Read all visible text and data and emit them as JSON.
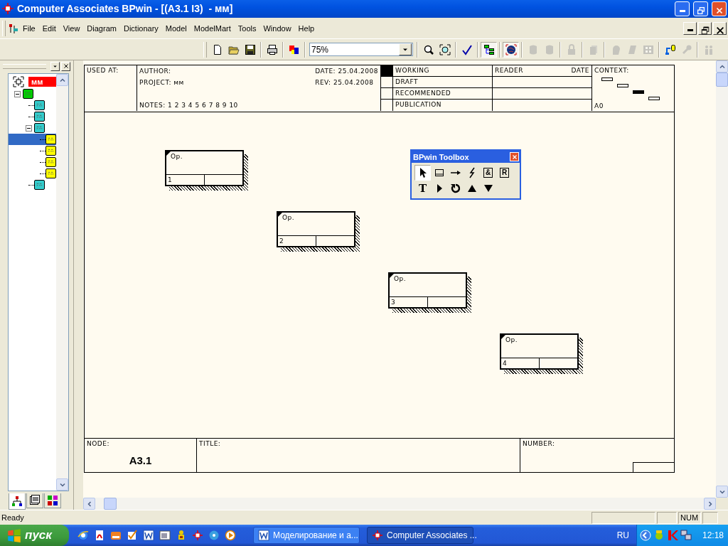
{
  "window": {
    "title": "Computer Associates BPwin - [(A3.1 I3)  - мм]"
  },
  "menu": [
    "File",
    "Edit",
    "View",
    "Diagram",
    "Dictionary",
    "Model",
    "ModelMart",
    "Tools",
    "Window",
    "Help"
  ],
  "toolbar": {
    "groups": [
      [
        {
          "kind": "new",
          "pressed": false,
          "disabled": false
        },
        {
          "kind": "open",
          "pressed": false,
          "disabled": false
        },
        {
          "kind": "save",
          "pressed": false,
          "disabled": false
        }
      ],
      [
        {
          "kind": "print",
          "pressed": false,
          "disabled": false
        }
      ],
      [
        {
          "kind": "colors",
          "pressed": false,
          "disabled": false
        }
      ],
      [
        {
          "kind": "combo",
          "value": "75%"
        }
      ],
      [
        {
          "kind": "zoom-in",
          "pressed": false,
          "disabled": false
        },
        {
          "kind": "zoom-fit",
          "pressed": false,
          "disabled": false
        }
      ],
      [
        {
          "kind": "spell",
          "pressed": false,
          "disabled": false
        }
      ],
      [
        {
          "kind": "tree",
          "pressed": true,
          "disabled": false
        }
      ],
      [
        {
          "kind": "globe",
          "pressed": true,
          "disabled": false
        }
      ],
      [
        {
          "kind": "cylinder",
          "pressed": false,
          "disabled": true
        },
        {
          "kind": "cylinder",
          "pressed": false,
          "disabled": true
        }
      ],
      [
        {
          "kind": "lock",
          "pressed": false,
          "disabled": true
        }
      ],
      [
        {
          "kind": "pages",
          "pressed": false,
          "disabled": true
        }
      ],
      [
        {
          "kind": "head",
          "pressed": false,
          "disabled": true
        },
        {
          "kind": "scroll",
          "pressed": false,
          "disabled": true
        },
        {
          "kind": "grid",
          "pressed": false,
          "disabled": true
        }
      ],
      [
        {
          "kind": "database",
          "pressed": false,
          "disabled": false
        },
        {
          "kind": "wrench",
          "pressed": false,
          "disabled": true
        }
      ],
      [
        {
          "kind": "people",
          "pressed": false,
          "disabled": true
        }
      ]
    ]
  },
  "tree": {
    "root": {
      "label": "мм"
    },
    "nodes": [
      {
        "color": "#00cc00",
        "expanded": true,
        "selected": false,
        "children": [
          {
            "color": "#33cccc",
            "selected": false
          },
          {
            "color": "#33cccc",
            "selected": false
          },
          {
            "color": "#33cccc",
            "expanded": true,
            "selected": false,
            "children": [
              {
                "color": "#ffff00",
                "selected": true
              },
              {
                "color": "#ffff00",
                "selected": false
              },
              {
                "color": "#ffff00",
                "selected": false
              },
              {
                "color": "#ffff00",
                "selected": false
              }
            ]
          },
          {
            "color": "#33cccc",
            "selected": false
          }
        ]
      }
    ]
  },
  "panel_tabs": [
    {
      "kind": "tree",
      "selected": true
    },
    {
      "kind": "list",
      "selected": false
    },
    {
      "kind": "grid",
      "selected": false
    }
  ],
  "diagram": {
    "header": {
      "used_at": "USED AT:",
      "author": "AUTHOR:",
      "project": "PROJECT:  мм",
      "notes": "NOTES:  1  2  3  4  5  6  7  8  9  10",
      "date": "DATE: 25.04.2008",
      "rev": "REV:   25.04.2008",
      "reader": "READER",
      "reader_date": "DATE",
      "context": "CONTEXT:",
      "context_node": "A0"
    },
    "statuses": [
      {
        "label": "WORKING",
        "selected": true
      },
      {
        "label": "DRAFT",
        "selected": false
      },
      {
        "label": "RECOMMENDED",
        "selected": false
      },
      {
        "label": "PUBLICATION",
        "selected": false
      }
    ],
    "context_boxes": [
      {
        "selected": false
      },
      {
        "selected": false
      },
      {
        "selected": true
      },
      {
        "selected": false
      }
    ],
    "boxes": [
      {
        "name": "Ор.",
        "number": "1"
      },
      {
        "name": "Ор.",
        "number": "2"
      },
      {
        "name": "Ор.",
        "number": "3"
      },
      {
        "name": "Ор.",
        "number": "4"
      }
    ],
    "footer": {
      "node_label": "NODE:",
      "node": "A3.1",
      "title_label": "TITLE:",
      "number_label": "NUMBER:"
    }
  },
  "toolbox": {
    "title": "BPwin Toolbox",
    "tools": [
      {
        "kind": "pointer",
        "selected": true
      },
      {
        "kind": "box",
        "selected": false
      },
      {
        "kind": "arrow",
        "selected": false
      },
      {
        "kind": "squiggle",
        "selected": false
      },
      {
        "kind": "boxed",
        "label": "&",
        "selected": false
      },
      {
        "kind": "boxed",
        "label": "R",
        "selected": false
      },
      {
        "kind": "text",
        "label": "T",
        "selected": false
      },
      {
        "kind": "triangle-right",
        "selected": false
      },
      {
        "kind": "rotate",
        "selected": false
      },
      {
        "kind": "triangle-up",
        "selected": false
      },
      {
        "kind": "triangle-down",
        "selected": false
      }
    ]
  },
  "status_bar": {
    "text": "Ready",
    "num": "NUM"
  },
  "taskbar": {
    "start": "пуск",
    "quick_launch": [
      {
        "kind": "ie"
      },
      {
        "kind": "pdf"
      },
      {
        "kind": "drawer"
      },
      {
        "kind": "check"
      },
      {
        "kind": "doc"
      },
      {
        "kind": "window"
      },
      {
        "kind": "figure"
      },
      {
        "kind": "crosshair"
      },
      {
        "kind": "disc"
      },
      {
        "kind": "play"
      }
    ],
    "tasks": [
      {
        "kind": "doc",
        "label": "Моделирование и а...",
        "selected": false
      },
      {
        "kind": "crosshair",
        "label": "Computer Associates ...",
        "selected": true
      }
    ],
    "language": "RU",
    "tray": [
      {
        "kind": "chevron"
      },
      {
        "kind": "bug"
      },
      {
        "kind": "flag"
      },
      {
        "kind": "network"
      }
    ],
    "clock": "12:18"
  }
}
